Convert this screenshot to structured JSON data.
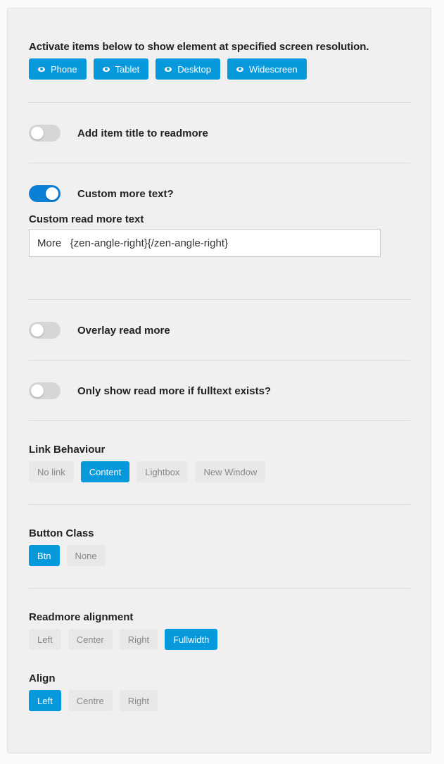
{
  "intro": {
    "text": "Activate items below to show element at specified screen resolution.",
    "visibility_buttons": [
      {
        "label": "Phone",
        "icon": "eye-icon"
      },
      {
        "label": "Tablet",
        "icon": "eye-icon"
      },
      {
        "label": "Desktop",
        "icon": "eye-icon"
      },
      {
        "label": "Widescreen",
        "icon": "eye-icon"
      }
    ]
  },
  "toggles": {
    "add_title": {
      "label": "Add item title to readmore",
      "on": false
    },
    "custom_more": {
      "label": "Custom more text?",
      "on": true
    },
    "overlay": {
      "label": "Overlay read more",
      "on": false
    },
    "fulltext_only": {
      "label": "Only show read more if fulltext exists?",
      "on": false
    }
  },
  "custom_text": {
    "label": "Custom read more text",
    "value": "More   {zen-angle-right}{/zen-angle-right}"
  },
  "link_behaviour": {
    "label": "Link Behaviour",
    "options": [
      "No link",
      "Content",
      "Lightbox",
      "New Window"
    ],
    "selected": "Content"
  },
  "button_class": {
    "label": "Button Class",
    "options": [
      "Btn",
      "None"
    ],
    "selected": "Btn"
  },
  "readmore_alignment": {
    "label": "Readmore alignment",
    "options": [
      "Left",
      "Center",
      "Right",
      "Fullwidth"
    ],
    "selected": "Fullwidth"
  },
  "align": {
    "label": "Align",
    "options": [
      "Left",
      "Centre",
      "Right"
    ],
    "selected": "Left"
  },
  "colors": {
    "accent": "#0899dd",
    "toggle_on": "#0a7fd6",
    "toggle_off": "#d6d6d6",
    "panel_bg": "#f0f0f0"
  }
}
